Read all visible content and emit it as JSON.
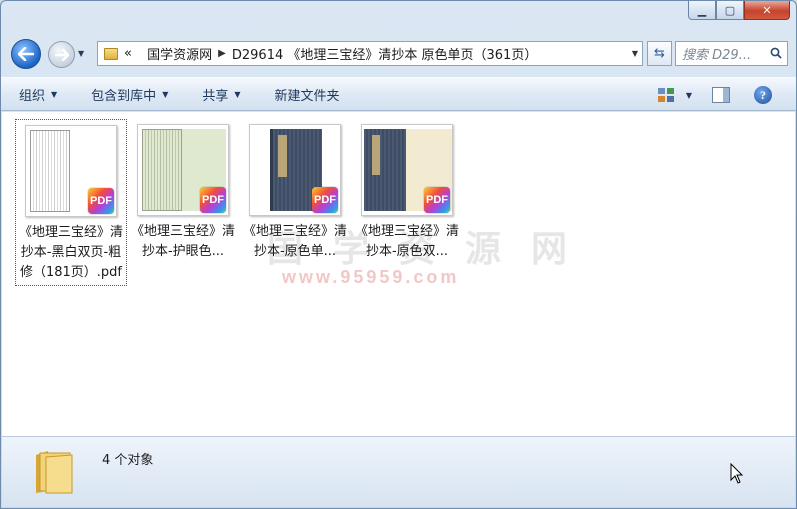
{
  "window": {
    "caption_buttons": [
      "minimize-icon",
      "maximize-icon",
      "close-icon"
    ]
  },
  "address": {
    "overflow": "«",
    "segments": [
      "国学资源网",
      "D29614 《地理三宝经》清抄本 原色单页（361页）"
    ],
    "search_placeholder": "搜索 D29..."
  },
  "toolbar": {
    "organize": "组织",
    "include_in_library": "包含到库中",
    "share": "共享",
    "new_folder": "新建文件夹"
  },
  "watermark": {
    "main": "国 学 资 源 网",
    "url": "www.95959.com"
  },
  "files": [
    {
      "name": "《地理三宝经》清抄本-黑白双页-粗修（181页）.pdf",
      "badge": "PDF",
      "selected": true
    },
    {
      "name": "《地理三宝经》清抄本-护眼色...",
      "badge": "PDF"
    },
    {
      "name": "《地理三宝经》清抄本-原色单...",
      "badge": "PDF"
    },
    {
      "name": "《地理三宝经》清抄本-原色双...",
      "badge": "PDF"
    }
  ],
  "status": {
    "count": "4 个对象"
  },
  "colors": {
    "toolbar_text": "#1e395b",
    "close_red": "#c6432b",
    "book_cover": "#4a5a72"
  }
}
